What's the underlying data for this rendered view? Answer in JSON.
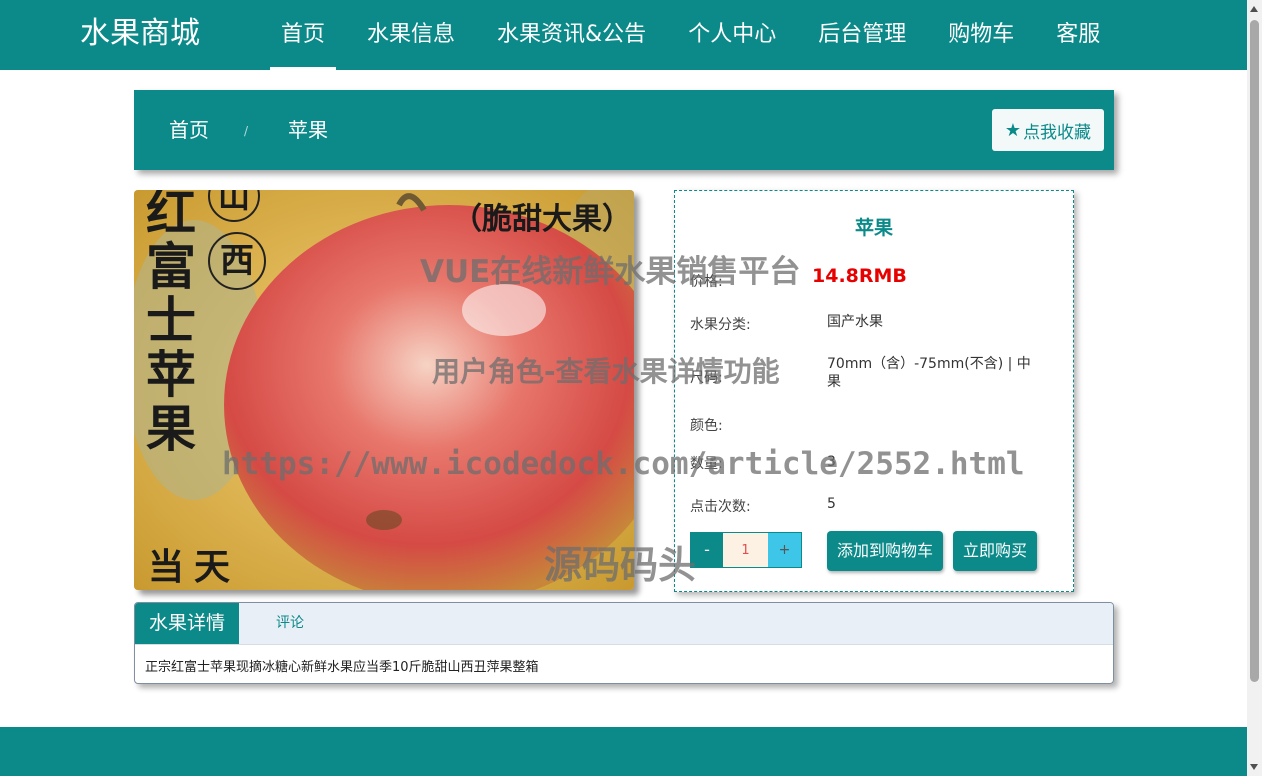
{
  "header": {
    "brand": "水果商城",
    "nav": [
      "首页",
      "水果信息",
      "水果资讯&公告",
      "个人中心",
      "后台管理",
      "购物车",
      "客服"
    ],
    "active_index": 0
  },
  "breadcrumb": {
    "home": "首页",
    "separator": "/",
    "current": "苹果",
    "favorite_label": "点我收藏"
  },
  "product_image": {
    "label_left_vertical": "红富士苹果",
    "label_circle_top": "山",
    "label_circle_bottom": "西",
    "label_top_right": "（脆甜大果）",
    "label_bottom": "当天"
  },
  "product": {
    "title": "苹果",
    "price_label": "价格:",
    "price": "14.8RMB",
    "category_label": "水果分类:",
    "category": "国产水果",
    "size_label": "尺码:",
    "size": "70mm（含）-75mm(不含) | 中果",
    "color_label": "颜色:",
    "color": "",
    "stock_label": "数量:",
    "stock": "3",
    "clicks_label": "点击次数:",
    "clicks": "5",
    "qty_minus": "-",
    "qty_value": "1",
    "qty_plus": "+",
    "add_to_cart": "添加到购物车",
    "buy_now": "立即购买"
  },
  "tabs": {
    "detail": "水果详情",
    "comments": "评论",
    "content": "正宗红富士苹果现摘冰糖心新鲜水果应当季10斤脆甜山西丑萍果整箱"
  },
  "watermarks": [
    "VUE在线新鲜水果销售平台",
    "用户角色-查看水果详情功能",
    "https://www.icodedock.com/article/2552.html",
    "源码码头"
  ],
  "colors": {
    "primary": "#0c8a8a",
    "price": "#e60000",
    "plus_button": "#3ec6e8"
  }
}
